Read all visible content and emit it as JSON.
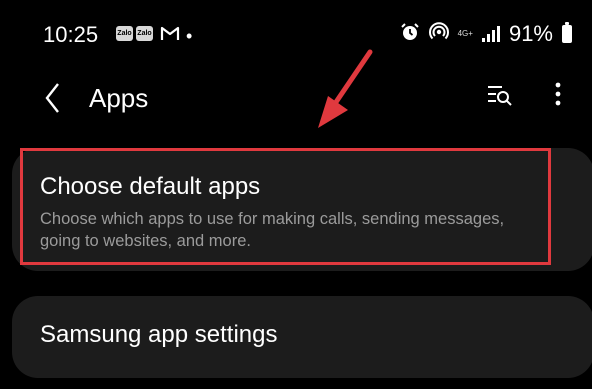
{
  "status_bar": {
    "time": "10:25",
    "notification_icons": [
      "Zalo",
      "Zalo",
      "gmail-icon"
    ],
    "dot": "•",
    "battery_percent": "91%",
    "network_label": "4G+"
  },
  "app_bar": {
    "title": "Apps"
  },
  "items": [
    {
      "title": "Choose default apps",
      "description": "Choose which apps to use for making calls, sending messages, going to websites, and more."
    },
    {
      "title": "Samsung app settings"
    }
  ],
  "colors": {
    "background": "#000000",
    "card": "#1c1c1c",
    "highlight": "#e0393e",
    "secondary_text": "#9b9b9b"
  }
}
